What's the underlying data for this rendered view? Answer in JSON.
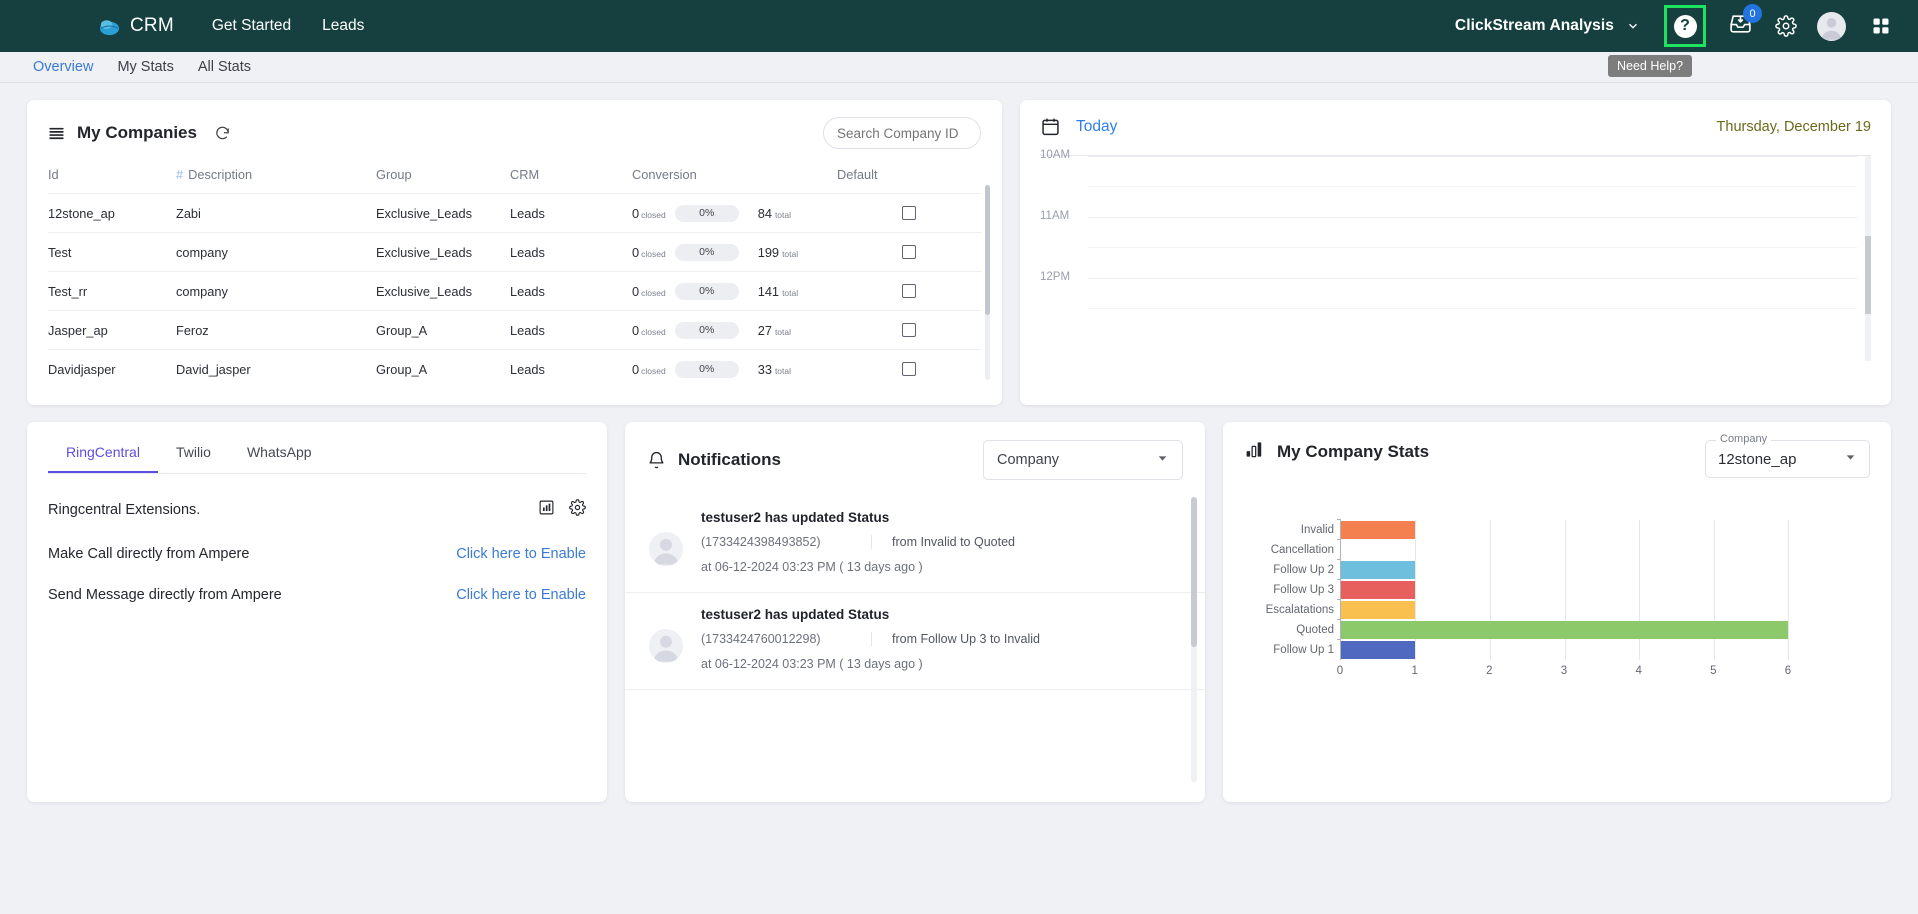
{
  "topnav": {
    "brand": "CRM",
    "links": [
      "Get Started",
      "Leads"
    ],
    "workspace": "ClickStream Analysis",
    "inbox_badge": "0",
    "help_glyph": "?",
    "tooltip": "Need Help?"
  },
  "subtabs": [
    {
      "label": "Overview",
      "active": true
    },
    {
      "label": "My Stats",
      "active": false
    },
    {
      "label": "All Stats",
      "active": false
    }
  ],
  "companies": {
    "title": "My Companies",
    "search_placeholder": "Search Company ID",
    "search_value": "",
    "columns": [
      "Id",
      "Description",
      "Group",
      "CRM",
      "Conversion",
      "Default"
    ],
    "hash_symbol": "#",
    "closed_label": "closed",
    "total_label": "total",
    "rows": [
      {
        "id": "12stone_ap",
        "description": "Zabi",
        "group": "Exclusive_Leads",
        "crm": "Leads",
        "closed": "0",
        "percent": "0%",
        "total": "84",
        "default": false
      },
      {
        "id": "Test",
        "description": "company",
        "group": "Exclusive_Leads",
        "crm": "Leads",
        "closed": "0",
        "percent": "0%",
        "total": "199",
        "default": false
      },
      {
        "id": "Test_rr",
        "description": "company",
        "group": "Exclusive_Leads",
        "crm": "Leads",
        "closed": "0",
        "percent": "0%",
        "total": "141",
        "default": false
      },
      {
        "id": "Jasper_ap",
        "description": "Feroz",
        "group": "Group_A",
        "crm": "Leads",
        "closed": "0",
        "percent": "0%",
        "total": "27",
        "default": false
      },
      {
        "id": "Davidjasper",
        "description": "David_jasper",
        "group": "Group_A",
        "crm": "Leads",
        "closed": "0",
        "percent": "0%",
        "total": "33",
        "default": false
      }
    ]
  },
  "today": {
    "link": "Today",
    "date": "Thursday, December 19",
    "times": [
      "10AM",
      "11AM",
      "12PM"
    ]
  },
  "ringcentral": {
    "tabs": [
      {
        "label": "RingCentral",
        "active": true
      },
      {
        "label": "Twilio",
        "active": false
      },
      {
        "label": "WhatsApp",
        "active": false
      }
    ],
    "heading": "Ringcentral Extensions.",
    "rows": [
      {
        "label": "Make Call directly from Ampere",
        "action": "Click here to Enable"
      },
      {
        "label": "Send Message directly from Ampere",
        "action": "Click here to Enable"
      }
    ]
  },
  "notifications": {
    "title": "Notifications",
    "filter_value": "Company",
    "items": [
      {
        "title": "testuser2 has updated Status",
        "id": "(1733424398493852)",
        "from": "from Invalid to Quoted",
        "time": "at 06-12-2024 03:23 PM ( 13 days ago )"
      },
      {
        "title": "testuser2 has updated Status",
        "id": "(1733424760012298)",
        "from": "from Follow Up 3 to Invalid",
        "time": "at 06-12-2024 03:23 PM ( 13 days ago )"
      }
    ]
  },
  "company_stats": {
    "title": "My Company Stats",
    "select_legend": "Company",
    "select_value": "12stone_ap"
  },
  "chart_data": {
    "type": "bar",
    "orientation": "horizontal",
    "title": "My Company Stats",
    "xlabel": "",
    "ylabel": "",
    "categories": [
      "Invalid",
      "Cancellation",
      "Follow Up 2",
      "Follow Up 3",
      "Escalatations",
      "Quoted",
      "Follow Up 1"
    ],
    "values": [
      1,
      0,
      1,
      1,
      1,
      6,
      1
    ],
    "colors": [
      "#f5804f",
      "#ffffff",
      "#6ebedd",
      "#e8605d",
      "#f9bf4f",
      "#8bc96a",
      "#4f69c0"
    ],
    "xlim": [
      0,
      6
    ],
    "xticks": [
      "0",
      "1",
      "2",
      "3",
      "4",
      "5",
      "6"
    ],
    "grid": true,
    "legend": "none"
  }
}
